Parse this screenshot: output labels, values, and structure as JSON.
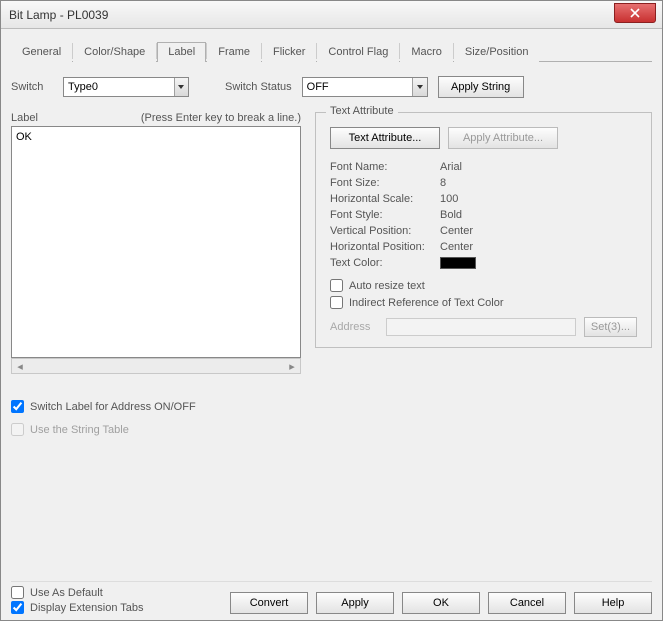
{
  "window": {
    "title": "Bit Lamp - PL0039"
  },
  "tabs": [
    "General",
    "Color/Shape",
    "Label",
    "Frame",
    "Flicker",
    "Control Flag",
    "Macro",
    "Size/Position"
  ],
  "active_tab_index": 2,
  "switch": {
    "label": "Switch",
    "value": "Type0"
  },
  "switch_status": {
    "label": "Switch Status",
    "value": "OFF"
  },
  "apply_string_btn": "Apply String",
  "label_box": {
    "label": "Label",
    "hint": "(Press Enter key to break a line.)",
    "value": "OK"
  },
  "text_attr": {
    "legend": "Text Attribute",
    "text_attr_btn": "Text Attribute...",
    "apply_attr_btn": "Apply Attribute...",
    "rows": {
      "font_name_label": "Font Name:",
      "font_name_value": "Arial",
      "font_size_label": "Font Size:",
      "font_size_value": "8",
      "hscale_label": "Horizontal Scale:",
      "hscale_value": "100",
      "font_style_label": "Font Style:",
      "font_style_value": "Bold",
      "vpos_label": "Vertical Position:",
      "vpos_value": "Center",
      "hpos_label": "Horizontal Position:",
      "hpos_value": "Center",
      "tcolor_label": "Text Color:",
      "tcolor_value": "#000000"
    },
    "auto_resize": {
      "label": "Auto resize text",
      "checked": false
    },
    "indirect_ref": {
      "label": "Indirect Reference of Text Color",
      "checked": false
    },
    "address_label": "Address",
    "set_btn": "Set(3)..."
  },
  "switch_label_onoff": {
    "label": "Switch Label for Address ON/OFF",
    "checked": true
  },
  "use_string_table": {
    "label": "Use the String Table",
    "checked": false
  },
  "bottom": {
    "use_as_default": {
      "label": "Use As Default",
      "checked": false
    },
    "display_ext_tabs": {
      "label": "Display Extension Tabs",
      "checked": true
    },
    "convert": "Convert",
    "apply": "Apply",
    "ok": "OK",
    "cancel": "Cancel",
    "help": "Help"
  }
}
